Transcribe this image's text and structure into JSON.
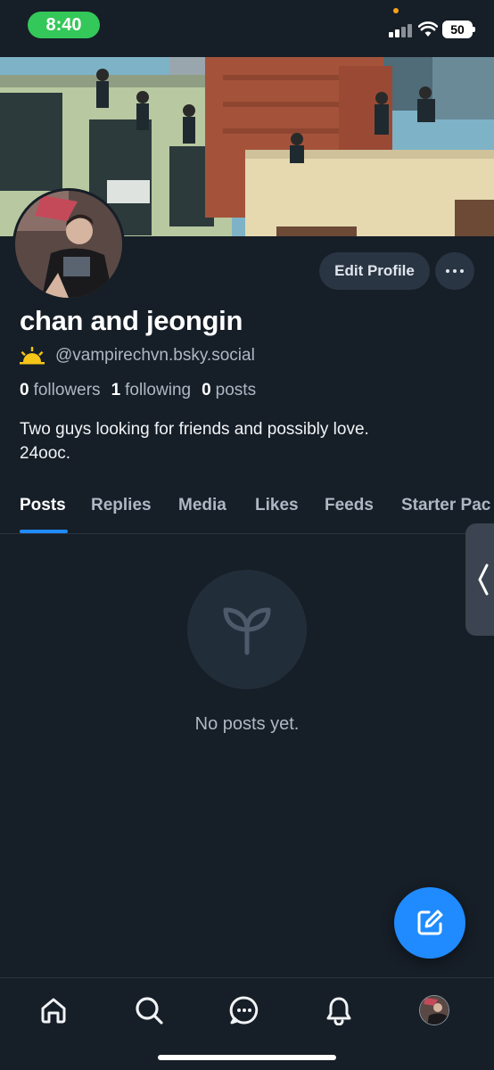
{
  "status_bar": {
    "time": "8:40",
    "battery": "50",
    "icons": [
      "signal-icon",
      "wifi-icon",
      "battery-icon"
    ]
  },
  "profile": {
    "display_name": "chan and jeongin",
    "handle": "@vampirechvn.bsky.social",
    "edit_label": "Edit Profile",
    "stats": {
      "followers_count": "0",
      "followers_label": "followers",
      "following_count": "1",
      "following_label": "following",
      "posts_count": "0",
      "posts_label": "posts"
    },
    "bio_line1": "Two guys looking for friends and possibly love.",
    "bio_line2": "24ooc."
  },
  "tabs": [
    {
      "label": "Posts",
      "active": true
    },
    {
      "label": "Replies"
    },
    {
      "label": "Media"
    },
    {
      "label": "Likes"
    },
    {
      "label": "Feeds"
    },
    {
      "label": "Starter Pac"
    }
  ],
  "empty_state": {
    "icon": "sprout-icon",
    "text": "No posts yet."
  },
  "fab": {
    "icon": "compose-icon"
  },
  "bottom_nav": [
    "home-icon",
    "search-icon",
    "chat-icon",
    "bell-icon",
    "profile-avatar"
  ],
  "colors": {
    "background": "#161e27",
    "accent": "#208bfe",
    "button": "#2a3543",
    "muted_text": "#aeb8c4",
    "status_pill": "#34c759"
  }
}
